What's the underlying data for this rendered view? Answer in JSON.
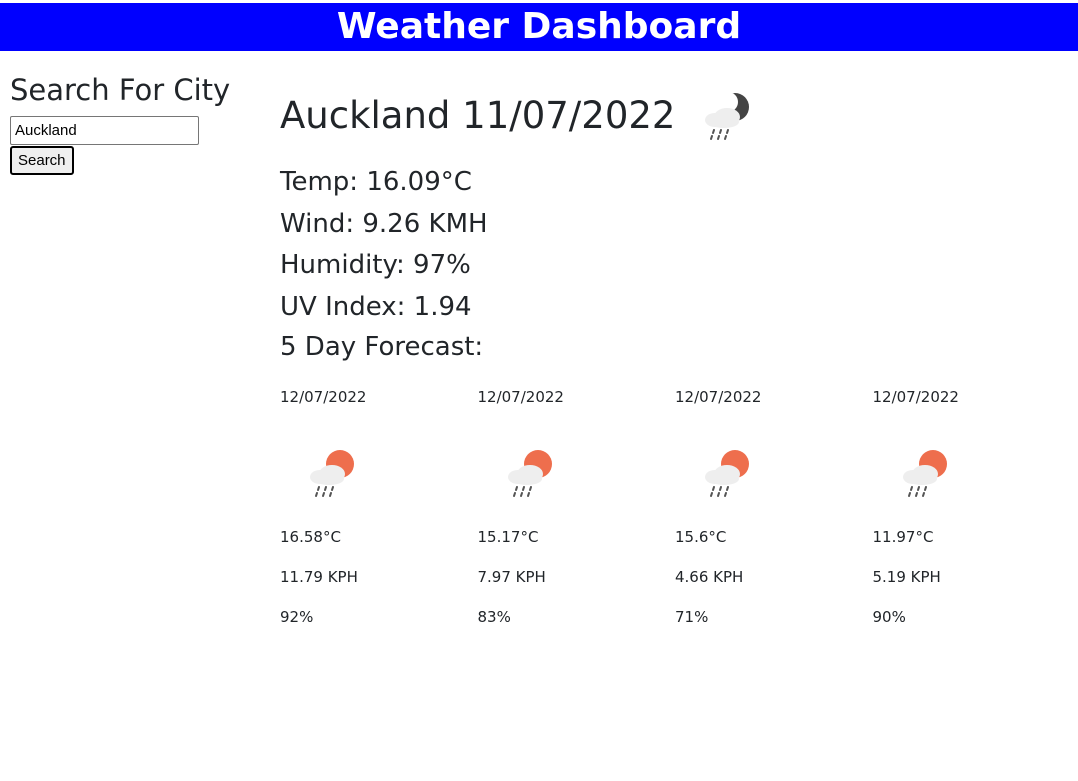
{
  "header": {
    "title": "Weather Dashboard"
  },
  "sidebar": {
    "heading": "Search For City",
    "search_value": "Auckland",
    "search_button": "Search"
  },
  "current": {
    "city_date": "Auckland 11/07/2022",
    "icon": "night-rain-cloud-icon",
    "temp": "Temp: 16.09°C",
    "wind": "Wind: 9.26 KMH",
    "humidity": "Humidity: 97%",
    "uv": "UV Index: 1.94"
  },
  "forecast": {
    "title": "5 Day Forecast:",
    "days": [
      {
        "date": "12/07/2022",
        "icon": "day-rain-cloud-icon",
        "temp": "16.58°C",
        "wind": "11.79 KPH",
        "humidity": "92%"
      },
      {
        "date": "12/07/2022",
        "icon": "day-rain-cloud-icon",
        "temp": "15.17°C",
        "wind": "7.97 KPH",
        "humidity": "83%"
      },
      {
        "date": "12/07/2022",
        "icon": "day-rain-cloud-icon",
        "temp": "15.6°C",
        "wind": "4.66 KPH",
        "humidity": "71%"
      },
      {
        "date": "12/07/2022",
        "icon": "day-rain-cloud-icon",
        "temp": "11.97°C",
        "wind": "5.19 KPH",
        "humidity": "90%"
      }
    ]
  },
  "colors": {
    "header_bg": "#0000ff",
    "sun": "#ee6e4d",
    "moon": "#444444",
    "cloud": "#eeeeee"
  }
}
